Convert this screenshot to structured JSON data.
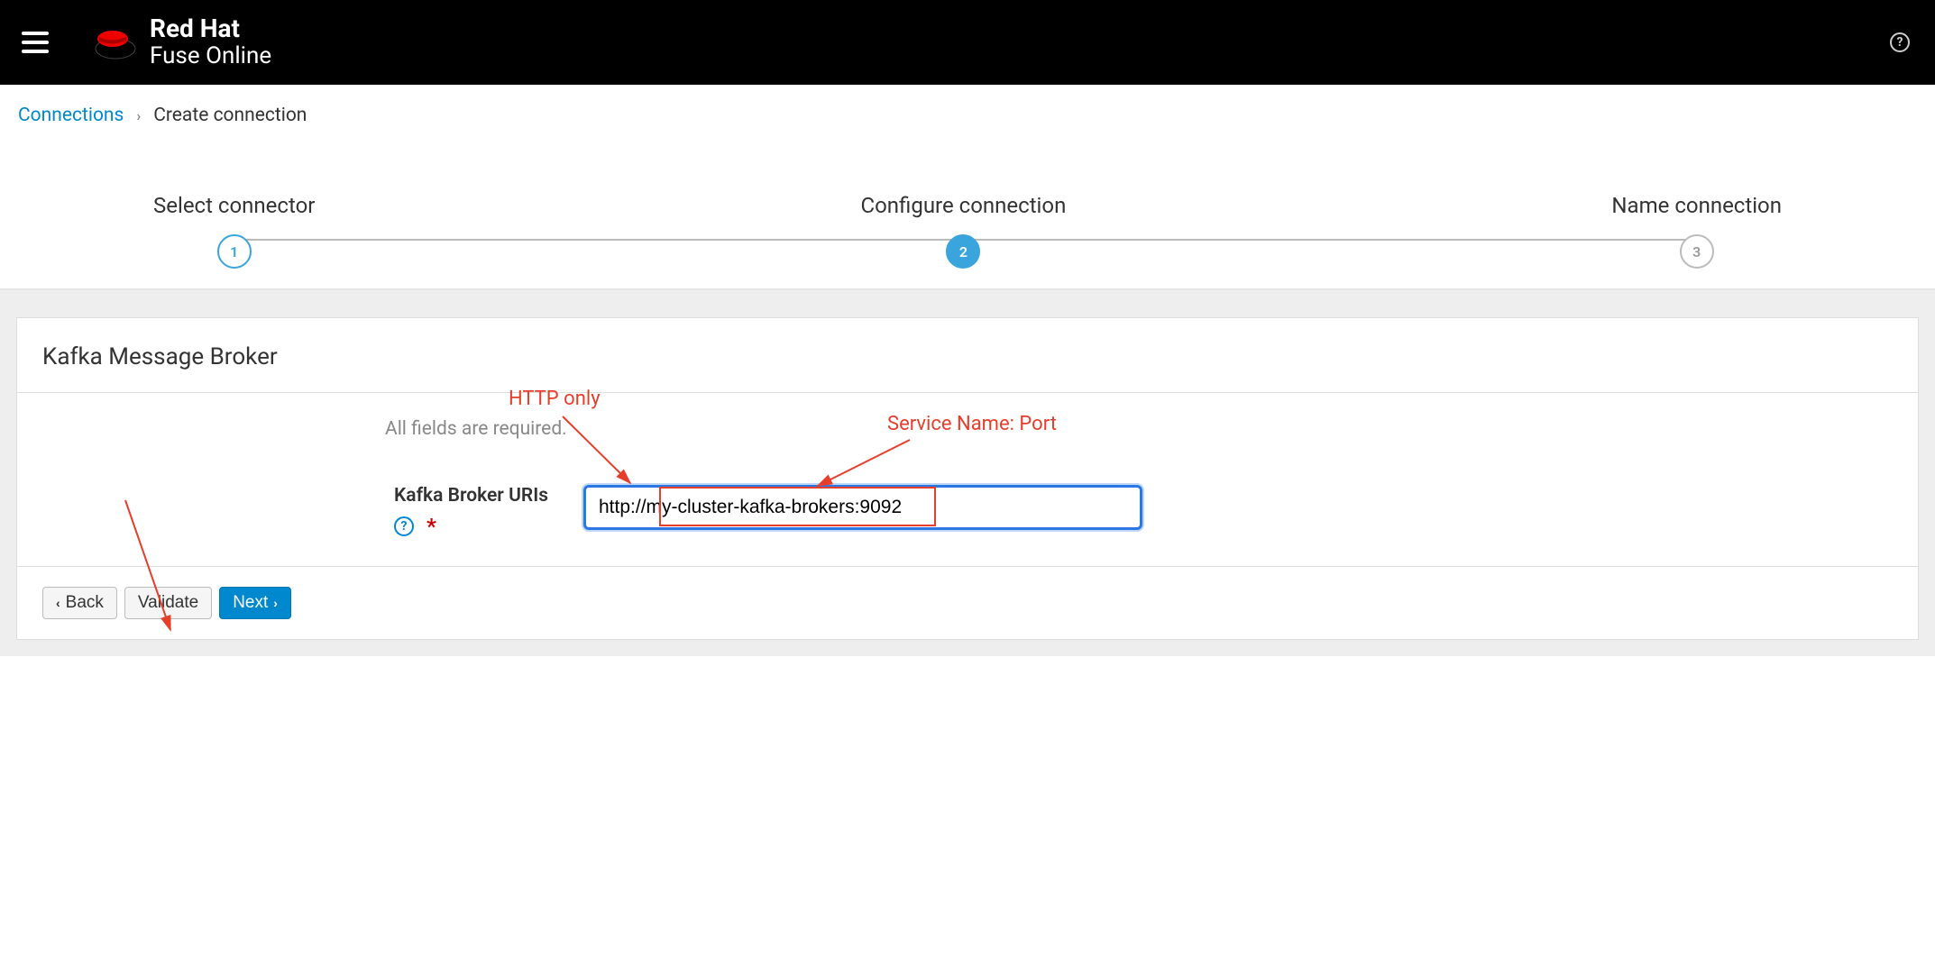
{
  "brand": {
    "title": "Red Hat",
    "subtitle": "Fuse Online"
  },
  "breadcrumb": {
    "root": "Connections",
    "current": "Create connection"
  },
  "wizard": {
    "steps": [
      {
        "label": "Select connector",
        "number": "1"
      },
      {
        "label": "Configure connection",
        "number": "2"
      },
      {
        "label": "Name connection",
        "number": "3"
      }
    ]
  },
  "panel": {
    "title": "Kafka Message Broker",
    "required_note": "All fields are required.",
    "field_label": "Kafka Broker URIs",
    "field_value": "http://my-cluster-kafka-brokers:9092",
    "required_star": "*"
  },
  "buttons": {
    "back": "Back",
    "validate": "Validate",
    "next": "Next"
  },
  "annotations": {
    "http_only": "HTTP only",
    "service_name_port": "Service Name: Port"
  }
}
